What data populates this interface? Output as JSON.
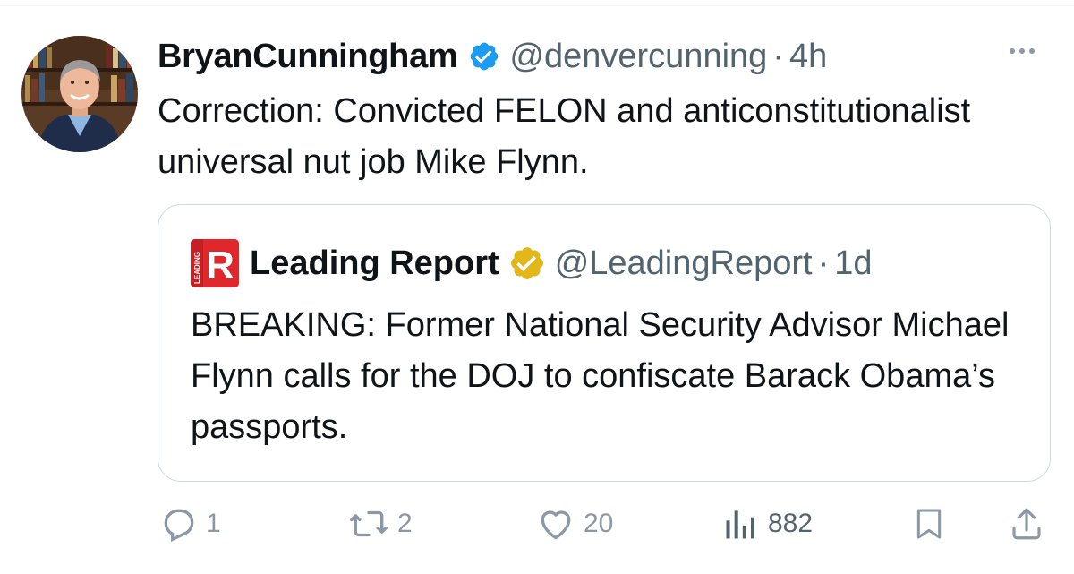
{
  "tweet": {
    "display_name": "BryanCunningham",
    "handle": "@denvercunning",
    "separator": "·",
    "time": "4h",
    "text": "Correction: Convicted FELON and anticonstitutionalist universal nut job Mike Flynn."
  },
  "quoted_tweet": {
    "display_name": "Leading Report",
    "handle": "@LeadingReport",
    "separator": "·",
    "time": "1d",
    "avatar_letter": "R",
    "avatar_side_text": "LEADING",
    "text": "BREAKING: Former National Security Advisor Michael Flynn calls for the DOJ to confiscate Barack Obama’s passports."
  },
  "actions": {
    "replies": "1",
    "retweets": "2",
    "likes": "20",
    "views": "882"
  },
  "colors": {
    "verified_blue": "#1d9bf0",
    "verified_gold": "#e2b719",
    "brand_red": "#e0282c",
    "secondary_text": "#536471",
    "icon_gray": "#8b98a5",
    "border": "#cfd9de"
  },
  "icons": [
    "verified-badge-icon",
    "gold-verified-badge-icon",
    "more-icon",
    "reply-icon",
    "retweet-icon",
    "like-icon",
    "views-icon",
    "bookmark-icon",
    "share-icon"
  ]
}
